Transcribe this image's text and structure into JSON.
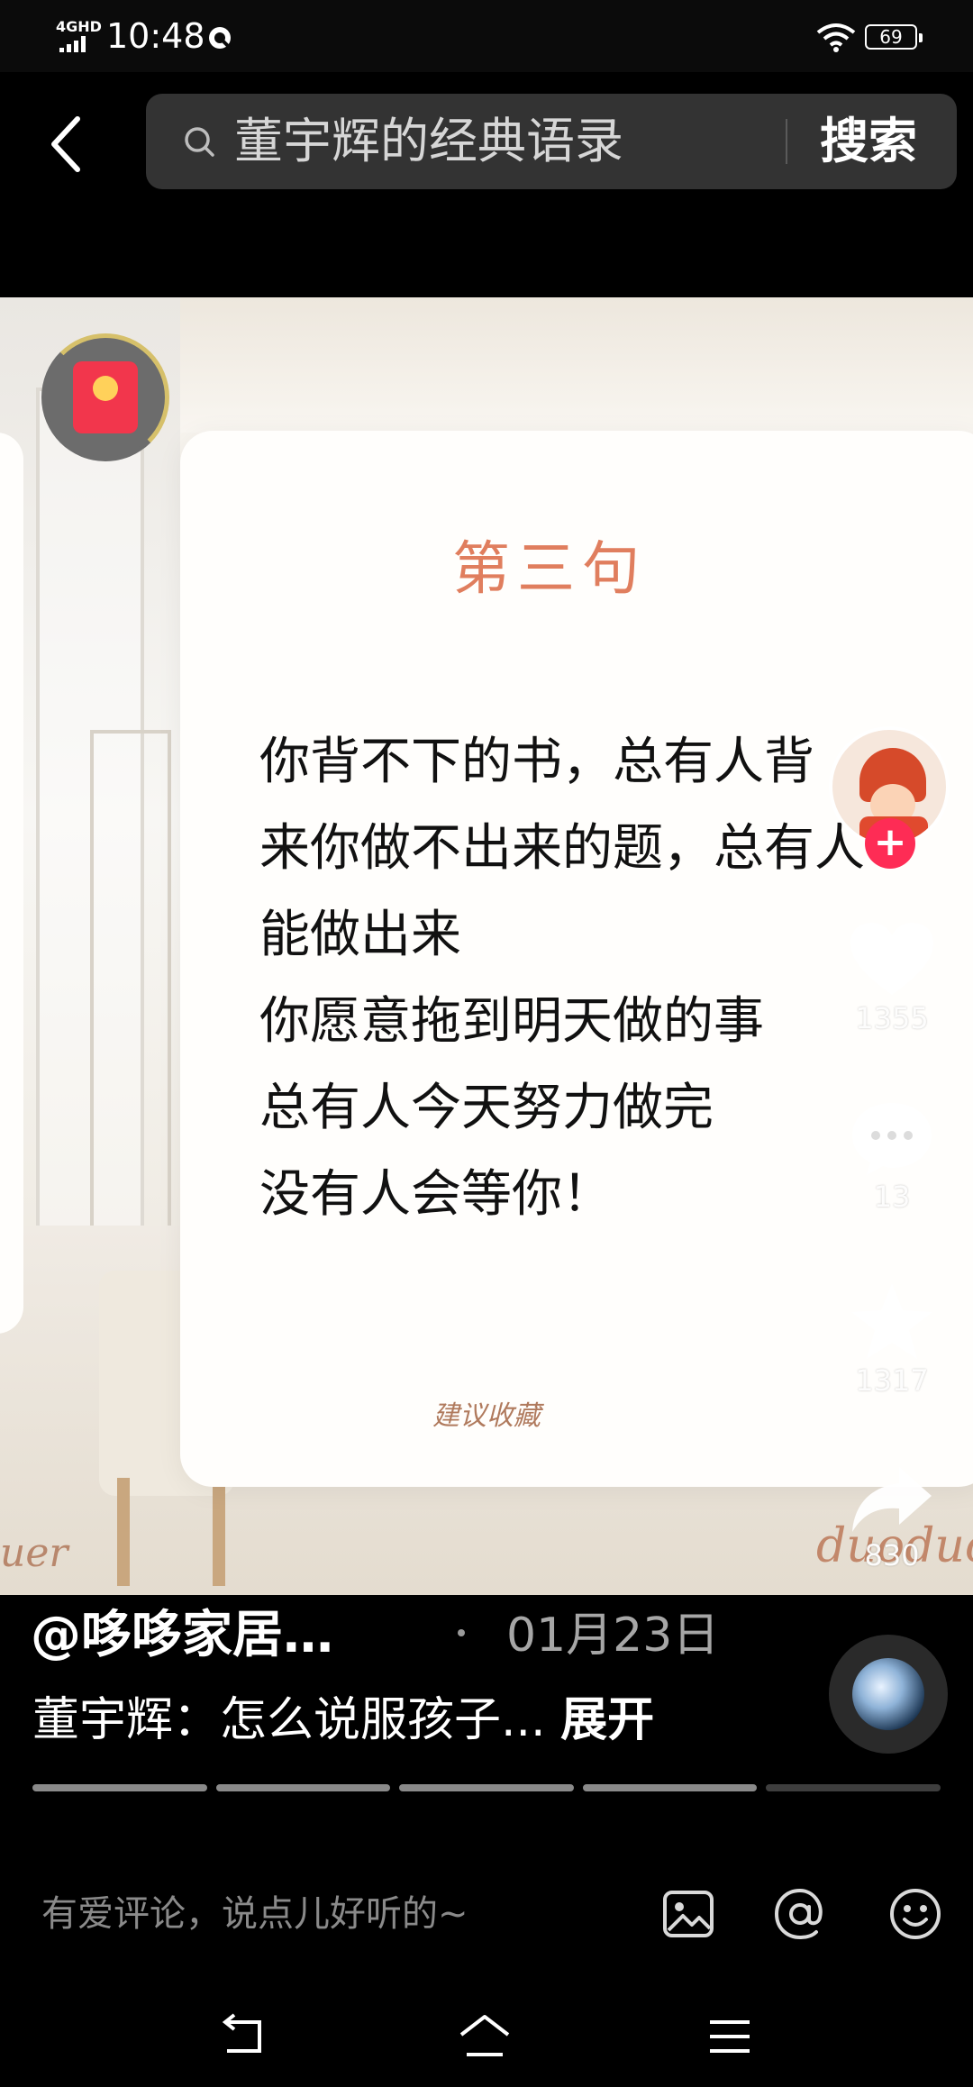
{
  "status_bar": {
    "network": "4GHD",
    "time": "10:48",
    "battery": "69"
  },
  "search": {
    "query": "董宇辉的经典语录",
    "button_label": "搜索"
  },
  "card": {
    "title": "第三句",
    "lines": [
      "你背不下的书，总有人背",
      "来你做不出来的题，总有人",
      "能做出来",
      "你愿意拖到明天做的事",
      "总有人今天努力做完",
      "没有人会等你！"
    ],
    "footnote": "建议收藏"
  },
  "watermarks": {
    "left": "uer",
    "right": "duoduoy"
  },
  "actions": {
    "likes": "1355",
    "comments": "13",
    "favorites": "1317",
    "shares": "830"
  },
  "post": {
    "author": "@哆哆家居…",
    "date": "01月23日",
    "description": "董宇辉：怎么说服孩子...",
    "expand_label": "展开"
  },
  "comment": {
    "placeholder": "有爱评论，说点儿好听的~"
  },
  "colors": {
    "accent_red": "#fe2c55",
    "card_title": "#e07e5e",
    "background": "#000000"
  }
}
